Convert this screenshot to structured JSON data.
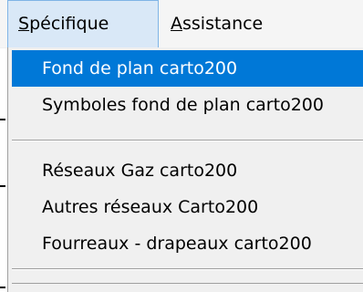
{
  "menubar": {
    "items": [
      {
        "mnemonic": "S",
        "rest": "pécifique"
      },
      {
        "mnemonic": "A",
        "rest": "ssistance"
      }
    ]
  },
  "dropdown": {
    "items": [
      {
        "label": "Fond de plan carto200",
        "highlighted": true
      },
      {
        "label": "Symboles fond de plan carto200"
      },
      {
        "label": "Réseaux Gaz carto200"
      },
      {
        "label": "Autres réseaux Carto200"
      },
      {
        "label": "Fourreaux - drapeaux carto200"
      }
    ]
  },
  "colors": {
    "menubar_bg": "#f5f5f5",
    "menu_bg": "#f0f0f0",
    "highlight": "#0078d7",
    "highlight_text": "#ffffff",
    "active_menubar_bg": "#d9e8f7",
    "active_menubar_border": "#7fb4e6"
  }
}
